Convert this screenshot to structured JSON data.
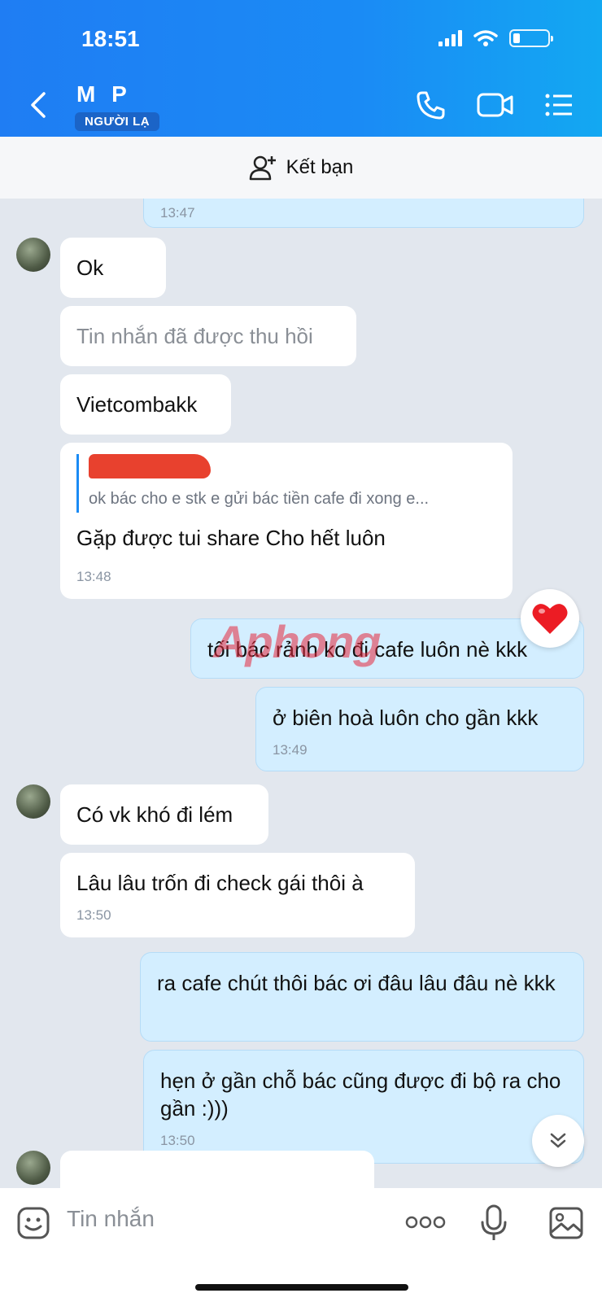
{
  "status_bar": {
    "time": "18:51"
  },
  "header": {
    "contact_name": "M P",
    "badge": "NGƯỜI LẠ"
  },
  "friend_bar": {
    "label": "Kết bạn"
  },
  "messages": [
    {
      "side": "me",
      "time": "13:47"
    },
    {
      "side": "them",
      "text": "Ok"
    },
    {
      "side": "them",
      "text": "Tin nhắn đã được thu hồi"
    },
    {
      "side": "them",
      "text": "Vietcombakk"
    },
    {
      "side": "them",
      "quote": "ok bác cho e stk e gửi bác tiền cafe đi xong e...",
      "text": "Gặp được tui share Cho hết luôn",
      "time": "13:48"
    },
    {
      "side": "me",
      "text": "tối bác rảnh ko đi cafe luôn nè kkk"
    },
    {
      "side": "me",
      "text": "ở biên hoà luôn cho gần kkk",
      "time": "13:49"
    },
    {
      "side": "them",
      "text": "Có vk khó đi lém"
    },
    {
      "side": "them",
      "text": "Lâu lâu trốn đi check gái thôi à",
      "time": "13:50"
    },
    {
      "side": "me",
      "text": "ra cafe chút thôi bác ơi đâu lâu đâu nè kkk"
    },
    {
      "side": "me",
      "text": "hẹn ở gần chỗ bác cũng được đi bộ ra cho gần :)))",
      "time": "13:50"
    }
  ],
  "watermark": "Aphong",
  "input": {
    "placeholder": "Tin nhắn"
  }
}
